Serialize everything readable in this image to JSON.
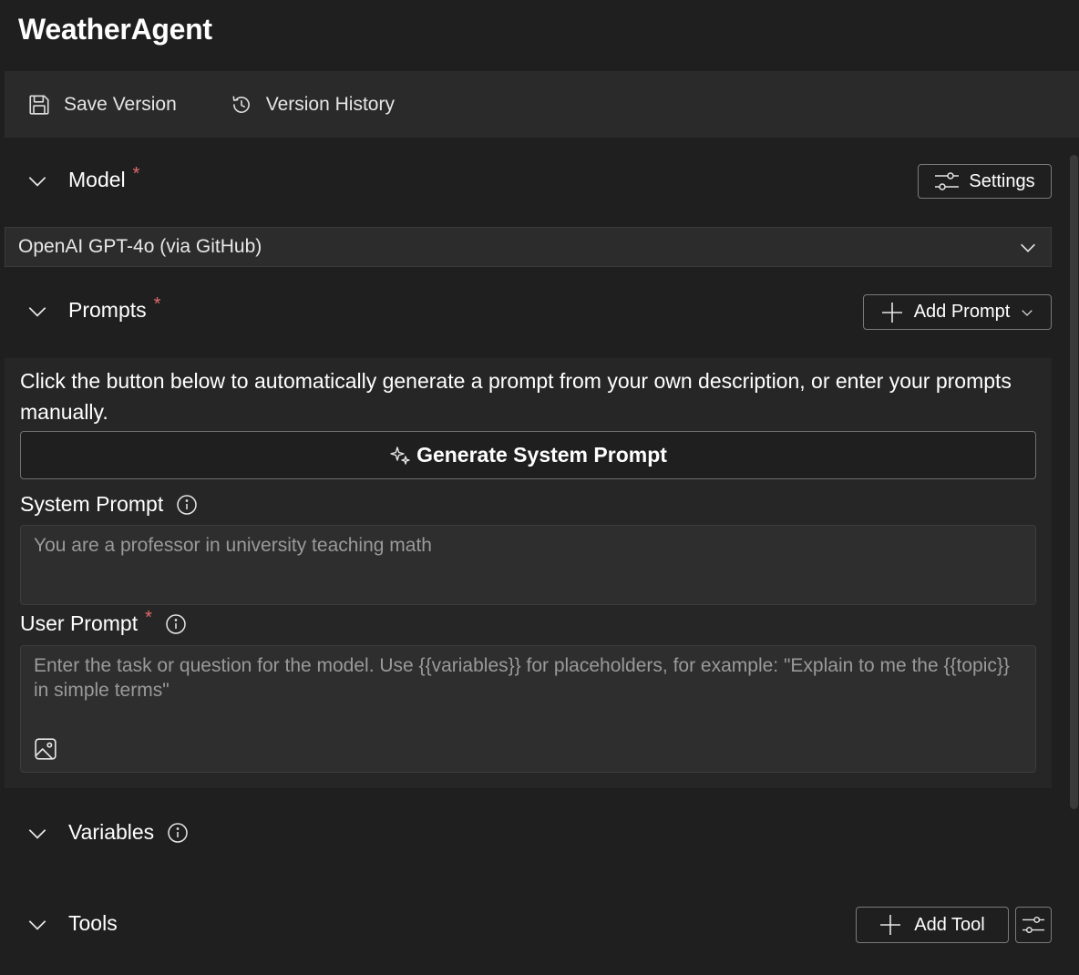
{
  "app": {
    "title": "WeatherAgent"
  },
  "toolbar": {
    "save_label": "Save Version",
    "history_label": "Version History"
  },
  "model": {
    "heading": "Model",
    "required_mark": "*",
    "settings_label": "Settings",
    "selected": "OpenAI GPT-4o (via GitHub)"
  },
  "prompts": {
    "heading": "Prompts",
    "required_mark": "*",
    "add_label": "Add Prompt",
    "description": "Click the button below to automatically generate a prompt from your own description, or enter your prompts manually.",
    "generate_label": "Generate System Prompt",
    "system_label": "System Prompt",
    "system_placeholder": "You are a professor in university teaching math",
    "user_label": "User Prompt",
    "user_required_mark": "*",
    "user_placeholder": "Enter the task or question for the model. Use {{variables}} for placeholders, for example: \"Explain to me the {{topic}} in simple terms\""
  },
  "variables": {
    "heading": "Variables"
  },
  "tools": {
    "heading": "Tools",
    "add_label": "Add Tool"
  },
  "icons": {
    "save": "save-icon",
    "history": "history-icon",
    "chevron": "chevron-down-icon",
    "settings": "sliders-icon",
    "add": "plus-icon",
    "sparkle": "sparkle-icon",
    "info": "info-icon",
    "image": "image-icon"
  },
  "colors": {
    "background": "#1f1f1f",
    "panel": "#262626",
    "required": "#e36a6a"
  }
}
